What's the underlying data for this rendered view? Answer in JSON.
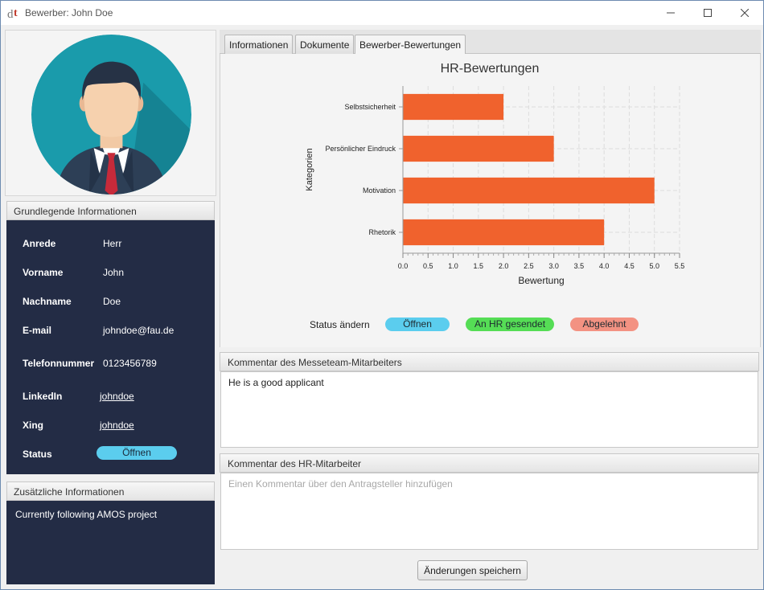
{
  "window": {
    "title": "Bewerber: John Doe"
  },
  "sidebar": {
    "basic_info_header": "Grundlegende Informationen",
    "fields": [
      {
        "label": "Anrede",
        "value": "Herr"
      },
      {
        "label": "Vorname",
        "value": "John"
      },
      {
        "label": "Nachname",
        "value": "Doe"
      },
      {
        "label": "E-mail",
        "value": "johndoe@fau.de"
      },
      {
        "label": "Telefonnummer",
        "value": "0123456789"
      },
      {
        "label": "LinkedIn",
        "value": "johndoe"
      },
      {
        "label": "Xing",
        "value": "johndoe"
      },
      {
        "label": "Status",
        "value": "Öffnen"
      }
    ],
    "additional_header": "Zusätzliche Informationen",
    "additional_text": "Currently following AMOS project"
  },
  "tabs": [
    {
      "label": "Informationen"
    },
    {
      "label": "Dokumente"
    },
    {
      "label": "Bewerber-Bewertungen",
      "active": true
    }
  ],
  "chart_data": {
    "type": "bar",
    "orientation": "horizontal",
    "title": "HR-Bewertungen",
    "xlabel": "Bewertung",
    "ylabel": "Kategorien",
    "categories": [
      "Selbstsicherheit",
      "Persönlicher Eindruck",
      "Motivation",
      "Rhetorik"
    ],
    "values": [
      2.0,
      3.0,
      5.0,
      4.0
    ],
    "xlim": [
      0,
      5.5
    ],
    "xticks": [
      "0.0",
      "0.5",
      "1.0",
      "1.5",
      "2.0",
      "2.5",
      "3.0",
      "3.5",
      "4.0",
      "4.5",
      "5.0",
      "5.5"
    ],
    "grid": true,
    "bar_color": "#f0622d"
  },
  "status_change": {
    "label": "Status ändern",
    "buttons": [
      {
        "label": "Öffnen",
        "color": "#5bcdee"
      },
      {
        "label": "An HR gesendet",
        "color": "#55dd55"
      },
      {
        "label": "Abgelehnt",
        "color": "#f39282"
      }
    ]
  },
  "comments": {
    "messeteam_header": "Kommentar des Messeteam-Mitarbeiters",
    "messeteam_text": "He is a good applicant",
    "hr_header": "Kommentar des HR-Mitarbeiter",
    "hr_placeholder": "Einen Kommentar über den Antragsteller hinzufügen"
  },
  "actions": {
    "save_label": "Änderungen speichern"
  }
}
